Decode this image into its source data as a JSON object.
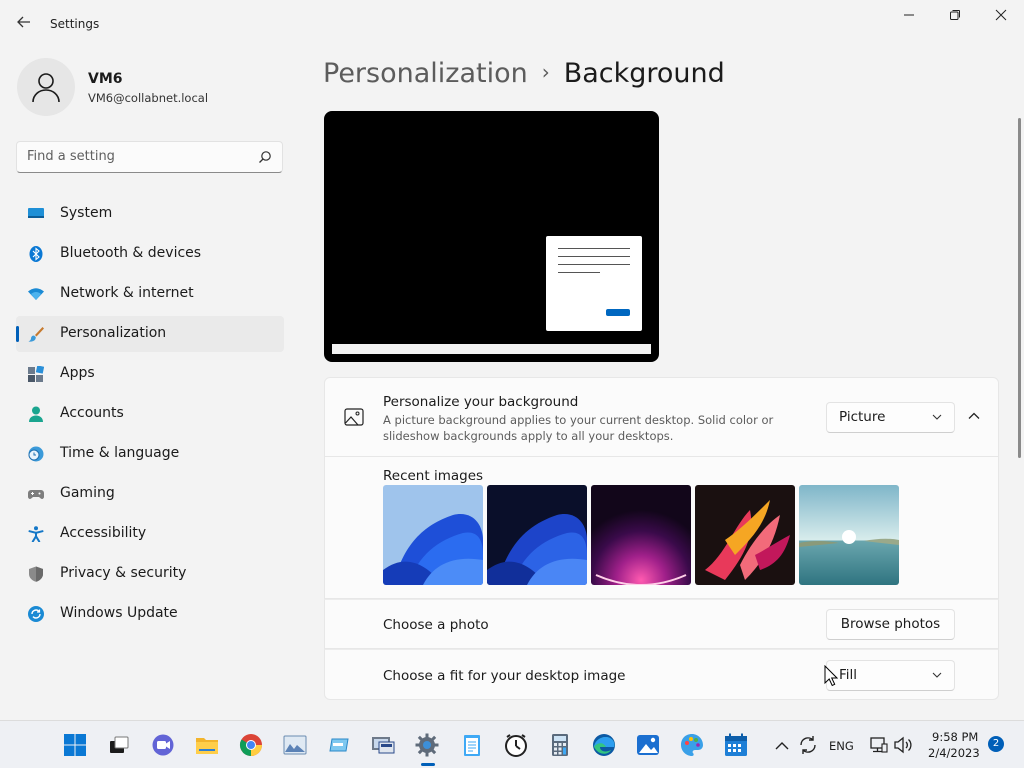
{
  "window": {
    "title": "Settings",
    "controls": [
      "minimize",
      "maximize",
      "close"
    ]
  },
  "user": {
    "name": "VM6",
    "email": "VM6@collabnet.local"
  },
  "search": {
    "placeholder": "Find a setting"
  },
  "sidebar": {
    "items": [
      {
        "label": "System",
        "icon": "system-icon"
      },
      {
        "label": "Bluetooth & devices",
        "icon": "bluetooth-icon"
      },
      {
        "label": "Network & internet",
        "icon": "wifi-icon"
      },
      {
        "label": "Personalization",
        "icon": "brush-icon",
        "active": true
      },
      {
        "label": "Apps",
        "icon": "apps-icon"
      },
      {
        "label": "Accounts",
        "icon": "accounts-icon"
      },
      {
        "label": "Time & language",
        "icon": "clock-globe-icon"
      },
      {
        "label": "Gaming",
        "icon": "gamepad-icon"
      },
      {
        "label": "Accessibility",
        "icon": "accessibility-icon"
      },
      {
        "label": "Privacy & security",
        "icon": "shield-icon"
      },
      {
        "label": "Windows Update",
        "icon": "update-icon"
      }
    ]
  },
  "breadcrumb": {
    "parent": "Personalization",
    "separator": "›",
    "current": "Background"
  },
  "background": {
    "personalize_title": "Personalize your background",
    "personalize_desc": "A picture background applies to your current desktop. Solid color or slideshow backgrounds apply to all your desktops.",
    "type_value": "Picture",
    "recent_images_label": "Recent images",
    "recent_images": [
      "blue-bloom-light",
      "blue-bloom-dark",
      "purple-glow",
      "red-ribbons",
      "lake-sunrise"
    ],
    "choose_photo_label": "Choose a photo",
    "browse_label": "Browse photos",
    "fit_label": "Choose a fit for your desktop image",
    "fit_value": "Fill"
  },
  "taskbar": {
    "apps": [
      "start",
      "task-view",
      "teams-chat",
      "file-explorer",
      "chrome",
      "photos",
      "storage",
      "remote-desktop",
      "settings",
      "notepad",
      "clock",
      "calculator",
      "edge",
      "photos-app",
      "paint",
      "calendar"
    ],
    "active_app": "settings",
    "language": "ENG",
    "time": "9:58 PM",
    "date": "2/4/2023",
    "notification_count": "2"
  },
  "colors": {
    "accent": "#005fb8",
    "background": "#f3f3f3",
    "card": "#fbfbfb"
  }
}
